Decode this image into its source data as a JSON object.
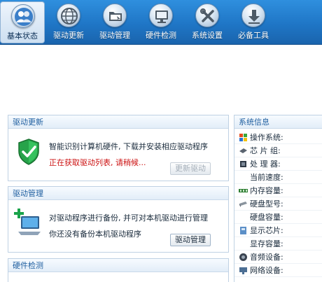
{
  "toolbar": {
    "items": [
      {
        "label": "基本状态",
        "icon": "users-icon"
      },
      {
        "label": "驱动更新",
        "icon": "globe-icon"
      },
      {
        "label": "驱动管理",
        "icon": "folder-icon"
      },
      {
        "label": "硬件检测",
        "icon": "monitor-icon"
      },
      {
        "label": "系统设置",
        "icon": "tools-icon"
      },
      {
        "label": "必备工具",
        "icon": "download-icon"
      }
    ],
    "active_index": 0
  },
  "panels": {
    "driver_update": {
      "title": "驱动更新",
      "description": "智能识别计算机硬件, 下载并安装相应驱动程序",
      "status": "正在获取驱动列表, 请稍候...",
      "button": "更新驱动"
    },
    "driver_manage": {
      "title": "驱动管理",
      "description": "对驱动程序进行备份, 并可对本机驱动进行管理",
      "status": "你还没有备份本机驱动程序",
      "button": "驱动管理"
    },
    "hardware_check": {
      "title": "硬件检测"
    }
  },
  "system_info": {
    "title": "系统信息",
    "rows": [
      {
        "label": "操作系统:",
        "icon": "windows-icon"
      },
      {
        "label": "芯 片 组:",
        "icon": "chip-icon"
      },
      {
        "label": "处 理 器:",
        "icon": "cpu-icon"
      },
      {
        "label": "当前速度:",
        "icon": ""
      },
      {
        "label": "内存容量:",
        "icon": "memory-icon"
      },
      {
        "label": "硬盘型号:",
        "icon": "harddisk-icon"
      },
      {
        "label": "硬盘容量:",
        "icon": ""
      },
      {
        "label": "显示芯片:",
        "icon": "display-icon"
      },
      {
        "label": "显存容量:",
        "icon": ""
      },
      {
        "label": "音频设备:",
        "icon": "audio-icon"
      },
      {
        "label": "网络设备:",
        "icon": "network-icon"
      }
    ]
  },
  "colors": {
    "toolbar_blue": "#1f76c6",
    "panel_title": "#1f5fa0",
    "status_red": "#cc1111"
  }
}
